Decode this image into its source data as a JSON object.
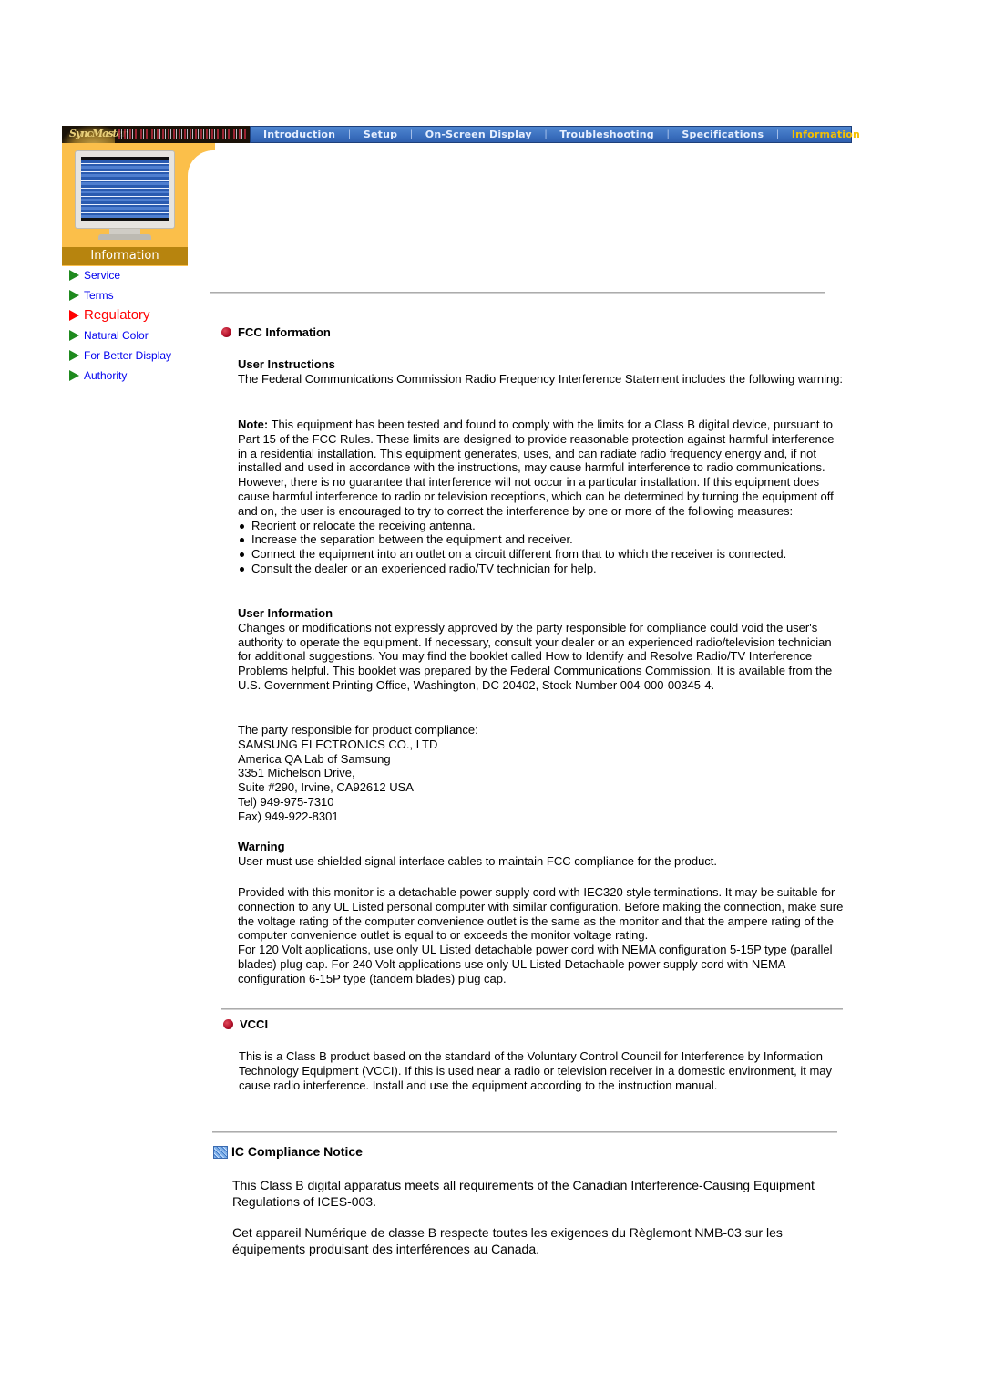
{
  "header": {
    "logo_text": "SyncMaster",
    "nav": [
      {
        "label": "Introduction",
        "active": false
      },
      {
        "label": "Setup",
        "active": false
      },
      {
        "label": "On-Screen Display",
        "active": false
      },
      {
        "label": "Troubleshooting",
        "active": false
      },
      {
        "label": "Specifications",
        "active": false
      },
      {
        "label": "Information",
        "active": true
      }
    ],
    "nav_separator": "|"
  },
  "side_panel": {
    "image": "monitor-illustration",
    "label": "Information"
  },
  "sidebar": {
    "items": [
      {
        "label": "Service",
        "active": false
      },
      {
        "label": "Terms",
        "active": false
      },
      {
        "label": "Regulatory",
        "active": true
      },
      {
        "label": "Natural Color",
        "active": false
      },
      {
        "label": "For Better Display",
        "active": false
      },
      {
        "label": "Authority",
        "active": false
      }
    ]
  },
  "fcc": {
    "title": "FCC Information",
    "user_instructions": {
      "heading": "User Instructions",
      "text": "The Federal Communications Commission Radio Frequency Interference Statement includes the following warning:"
    },
    "note": {
      "label": "Note:",
      "text": " This equipment has been tested and found to comply with the limits for a Class B digital device, pursuant to Part 15 of the FCC Rules. These limits are designed to provide reasonable protection against harmful interference in a residential installation. This equipment generates, uses, and can radiate radio frequency energy and, if not installed and used in accordance with the instructions, may cause harmful interference to radio communications. However, there is no guarantee that interference will not occur in a particular installation. If this equipment does cause harmful interference to radio or television receptions, which can be determined by turning the equipment off and on, the user is encouraged to try to correct the interference by one or more of the following measures:"
    },
    "measures": [
      "Reorient or relocate the receiving antenna.",
      "Increase the separation between the equipment and receiver.",
      "Connect the equipment into an outlet on a circuit different from that to which the receiver is connected.",
      "Consult the dealer or an experienced radio/TV technician for help."
    ],
    "user_information": {
      "heading": "User Information",
      "text": "Changes or modifications not expressly approved by the party responsible for compliance could void the user's authority to operate the equipment. If necessary, consult your dealer or an experienced radio/television technician for additional suggestions. You may find the booklet called How to Identify and Resolve Radio/TV Interference Problems helpful. This booklet was prepared by the Federal Communications Commission. It is available from the U.S. Government Printing Office, Washington, DC 20402, Stock Number 004-000-00345-4."
    },
    "party": {
      "intro": "The party responsible for product compliance:",
      "lines": [
        "SAMSUNG ELECTRONICS CO., LTD",
        "America QA Lab of Samsung",
        "3351 Michelson Drive,",
        "Suite #290, Irvine, CA92612 USA",
        "Tel) 949-975-7310",
        "Fax) 949-922-8301"
      ]
    },
    "warning": {
      "heading": "Warning",
      "text": "User must use shielded signal interface cables to maintain FCC compliance for the product."
    },
    "power_cord": {
      "text1": "Provided with this monitor is a detachable power supply cord with IEC320 style terminations. It may be suitable for connection to any UL Listed personal computer with similar configuration. Before making the connection, make sure the voltage rating of the computer convenience outlet is the same as the monitor and that the ampere rating of the computer convenience outlet is equal to or exceeds the monitor voltage rating.",
      "text2": "For 120 Volt applications, use only UL Listed detachable power cord with NEMA configuration 5-15P type (parallel blades) plug cap. For 240 Volt applications use only UL Listed Detachable power supply cord with NEMA configuration 6-15P type (tandem blades) plug cap."
    }
  },
  "vcci": {
    "title": "VCCI",
    "text": "This is a Class B product based on the standard of the Voluntary Control Council for Interference by Information Technology Equipment (VCCI). If this is used near a radio or television receiver in a domestic environment, it may cause radio interference. Install and use the equipment according to the instruction manual."
  },
  "ic": {
    "title": "IC Compliance Notice",
    "text_en": "This Class B digital apparatus meets all requirements of the Canadian Interference-Causing Equipment Regulations of ICES-003.",
    "text_fr": "Cet appareil Numérique de classe B respecte toutes les exigences du Règlemont NMB-03 sur les équipements produisant des interférences au Canada."
  },
  "colors": {
    "nav_bg": "#3a6fbe",
    "nav_active": "#f5c000",
    "panel_yellow": "#fbbf4a",
    "panel_label_bg": "#b7840e",
    "link": "#0000ee",
    "link_active": "#ff0000",
    "arrow": "#1f8a1f"
  }
}
